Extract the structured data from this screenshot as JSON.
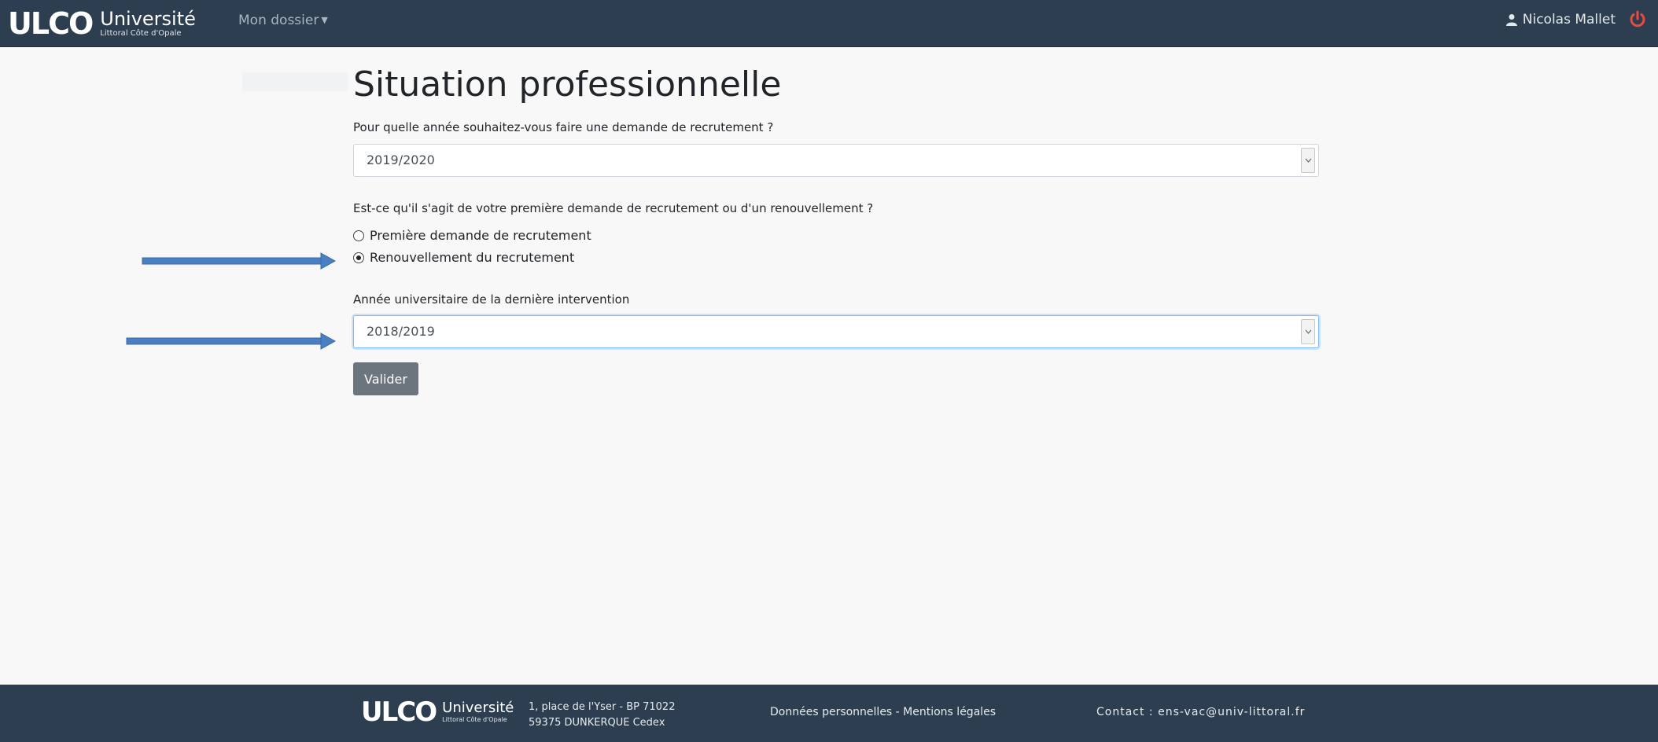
{
  "header": {
    "logo_mark": "ULCO",
    "logo_name": "Université",
    "logo_sub": "Littoral Côte d'Opale",
    "nav_dossier": "Mon dossier",
    "user_name": "Nicolas Mallet"
  },
  "main": {
    "title": "Situation professionnelle",
    "question_year": "Pour quelle année souhaitez-vous faire une demande de recrutement ?",
    "select_year_value": "2019/2020",
    "question_type": "Est-ce qu'il s'agit de votre première demande de recrutement ou d'un renouvellement ?",
    "radio_options": [
      {
        "label": "Première demande de recrutement",
        "checked": false
      },
      {
        "label": "Renouvellement du recrutement",
        "checked": true
      }
    ],
    "question_last": "Année universitaire de la dernière intervention",
    "select_last_value": "2018/2019",
    "submit_label": "Valider"
  },
  "footer": {
    "logo_mark": "ULCO",
    "logo_name": "Université",
    "logo_sub": "Littoral Côte d'Opale",
    "address_line1": "1, place de l'Yser - BP 71022",
    "address_line2": "59375 DUNKERQUE Cedex",
    "links": "Données personnelles - Mentions légales",
    "contact": "Contact : ens-vac@univ-littoral.fr"
  },
  "colors": {
    "header_bg": "#2c3e50",
    "annotation_arrow": "#4a7fc1",
    "power_icon": "#e74c3c",
    "button_bg": "#6c757d"
  }
}
